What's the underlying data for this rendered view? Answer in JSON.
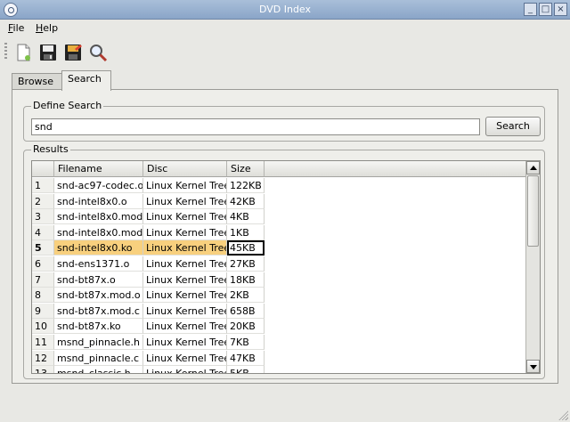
{
  "window": {
    "title": "DVD Index"
  },
  "menu": {
    "file": "File",
    "help": "Help"
  },
  "toolbar": {
    "icons": [
      "new-document-icon",
      "save-icon",
      "save-as-icon",
      "search-magnifier-icon"
    ]
  },
  "tabs": [
    {
      "label": "Browse",
      "active": false
    },
    {
      "label": "Search",
      "active": true
    }
  ],
  "define_search": {
    "title": "Define Search",
    "query": "snd",
    "button": "Search"
  },
  "results": {
    "title": "Results",
    "columns": {
      "filename": "Filename",
      "disc": "Disc",
      "size": "Size"
    },
    "selected_index": 4,
    "rows": [
      {
        "n": "1",
        "filename": "snd-ac97-codec.o",
        "disc": "Linux Kernel Tree",
        "size": "122KB"
      },
      {
        "n": "2",
        "filename": "snd-intel8x0.o",
        "disc": "Linux Kernel Tree",
        "size": "42KB"
      },
      {
        "n": "3",
        "filename": "snd-intel8x0.mod.o",
        "disc": "Linux Kernel Tree",
        "size": "4KB"
      },
      {
        "n": "4",
        "filename": "snd-intel8x0.mod.c",
        "disc": "Linux Kernel Tree",
        "size": "1KB"
      },
      {
        "n": "5",
        "filename": "snd-intel8x0.ko",
        "disc": "Linux Kernel Tree",
        "size": "45KB"
      },
      {
        "n": "6",
        "filename": "snd-ens1371.o",
        "disc": "Linux Kernel Tree",
        "size": "27KB"
      },
      {
        "n": "7",
        "filename": "snd-bt87x.o",
        "disc": "Linux Kernel Tree",
        "size": "18KB"
      },
      {
        "n": "8",
        "filename": "snd-bt87x.mod.o",
        "disc": "Linux Kernel Tree",
        "size": "2KB"
      },
      {
        "n": "9",
        "filename": "snd-bt87x.mod.c",
        "disc": "Linux Kernel Tree",
        "size": "658B"
      },
      {
        "n": "10",
        "filename": "snd-bt87x.ko",
        "disc": "Linux Kernel Tree",
        "size": "20KB"
      },
      {
        "n": "11",
        "filename": "msnd_pinnacle.h",
        "disc": "Linux Kernel Tree",
        "size": "7KB"
      },
      {
        "n": "12",
        "filename": "msnd_pinnacle.c",
        "disc": "Linux Kernel Tree",
        "size": "47KB"
      },
      {
        "n": "13",
        "filename": "msnd_classic.h",
        "disc": "Linux Kernel Tree",
        "size": "5KB"
      }
    ]
  },
  "colors": {
    "selection": "#f8d07e",
    "titlebar": "#96aecd"
  }
}
